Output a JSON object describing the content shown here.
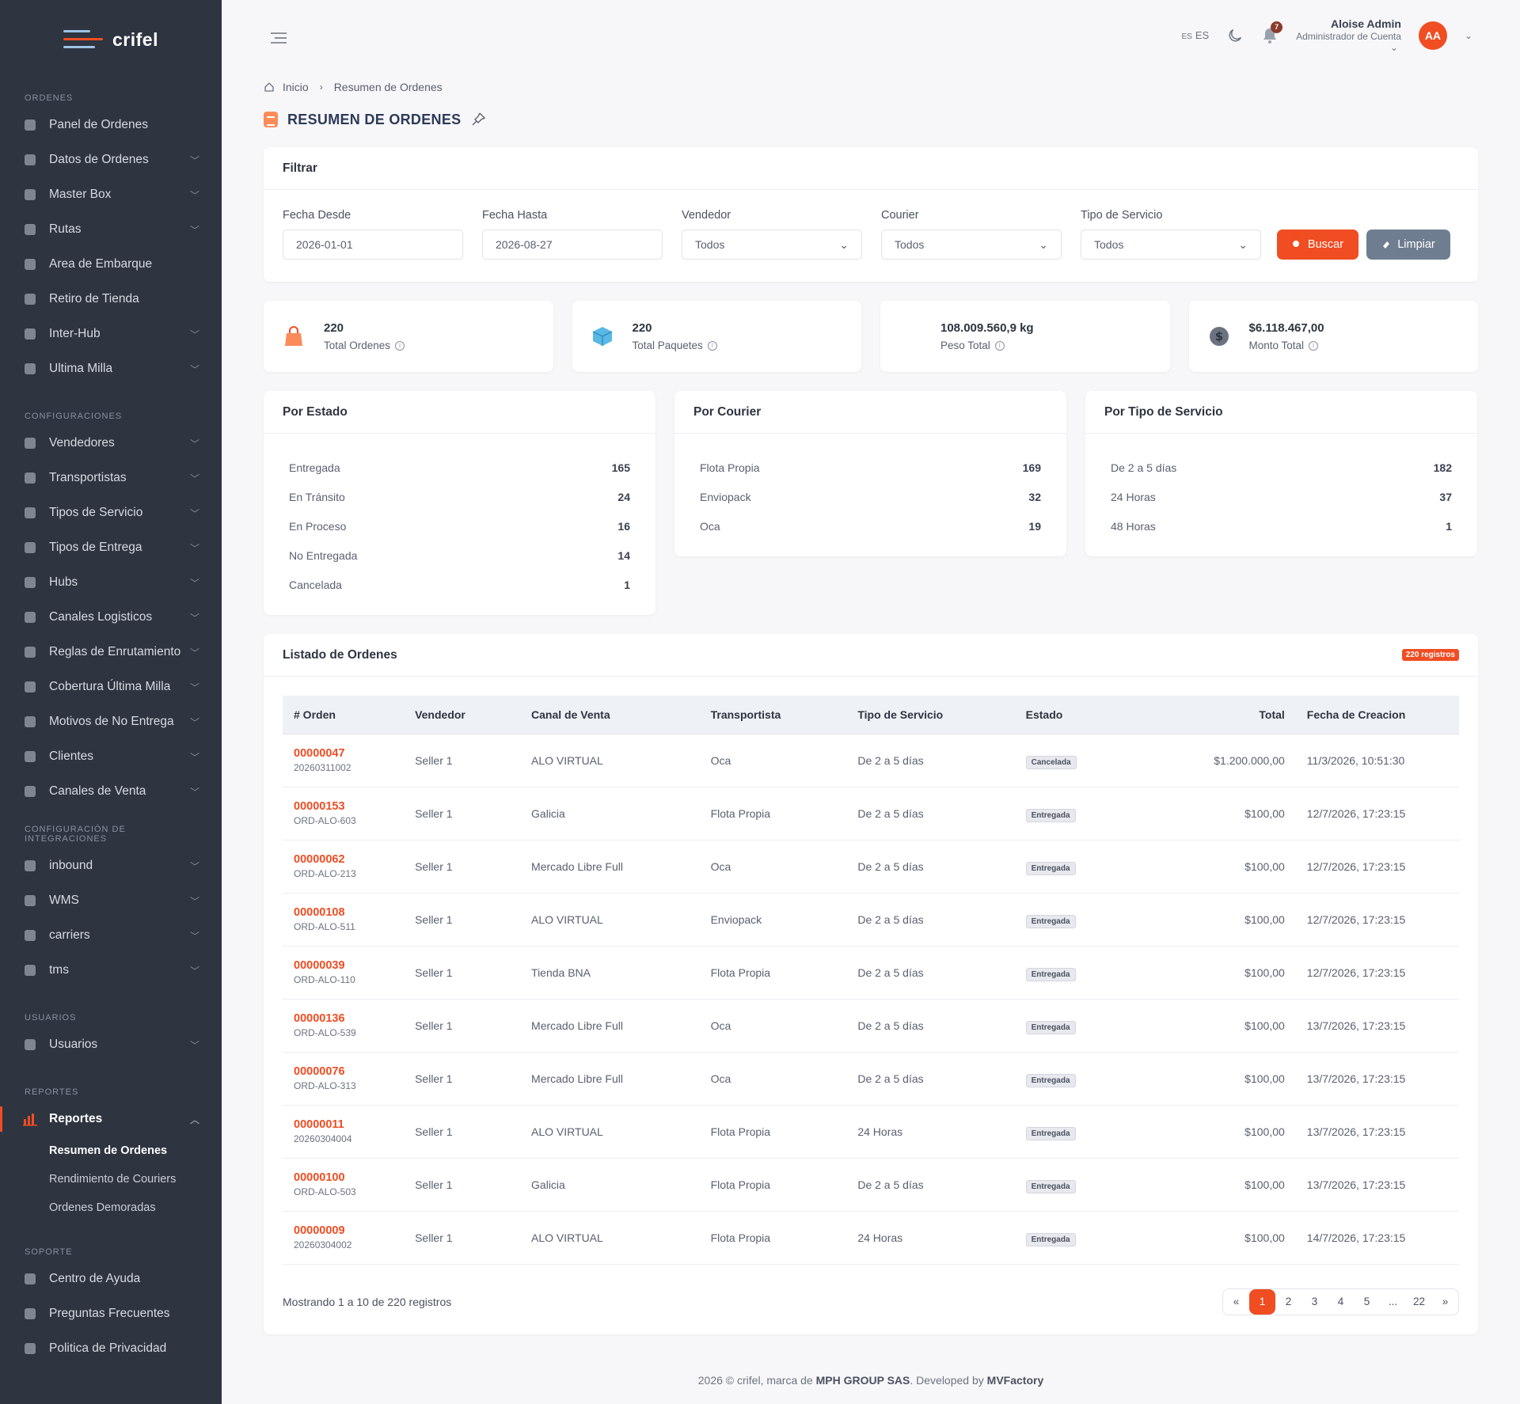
{
  "brand": {
    "name": "crifel"
  },
  "sidebar": {
    "sections": [
      {
        "title": "ORDENES",
        "items": [
          {
            "label": "Panel de Ordenes",
            "icon": "dashboard-icon",
            "chevron": false
          },
          {
            "label": "Datos de Ordenes",
            "icon": "box-icon",
            "chevron": true
          },
          {
            "label": "Master Box",
            "icon": "cube-icon",
            "chevron": true
          },
          {
            "label": "Rutas",
            "icon": "route-icon",
            "chevron": true
          },
          {
            "label": "Area de Embarque",
            "icon": "dock-icon",
            "chevron": false
          },
          {
            "label": "Retiro de Tienda",
            "icon": "store-icon",
            "chevron": false
          },
          {
            "label": "Inter-Hub",
            "icon": "building-icon",
            "chevron": true
          },
          {
            "label": "Ultima Milla",
            "icon": "delivery-icon",
            "chevron": true
          }
        ]
      },
      {
        "title": "CONFIGURACIONES",
        "items": [
          {
            "label": "Vendedores",
            "icon": "seller-icon",
            "chevron": true
          },
          {
            "label": "Transportistas",
            "icon": "truck-icon",
            "chevron": true
          },
          {
            "label": "Tipos de Servicio",
            "icon": "service-icon",
            "chevron": true
          },
          {
            "label": "Tipos de Entrega",
            "icon": "package-icon",
            "chevron": true
          },
          {
            "label": "Hubs",
            "icon": "hub-icon",
            "chevron": true
          },
          {
            "label": "Canales Logisticos",
            "icon": "logistics-icon",
            "chevron": true
          },
          {
            "label": "Reglas de Enrutamiento",
            "icon": "rules-icon",
            "chevron": true
          },
          {
            "label": "Cobertura Última Milla",
            "icon": "coverage-icon",
            "chevron": true
          },
          {
            "label": "Motivos de No Entrega",
            "icon": "reason-icon",
            "chevron": true
          },
          {
            "label": "Clientes",
            "icon": "clients-icon",
            "chevron": true
          },
          {
            "label": "Canales de Venta",
            "icon": "sales-channel-icon",
            "chevron": true
          }
        ]
      },
      {
        "title": "CONFIGURACIÓN DE INTEGRACIONES",
        "items": [
          {
            "label": "inbound",
            "icon": "inbound-icon",
            "chevron": true
          },
          {
            "label": "WMS",
            "icon": "wms-icon",
            "chevron": true
          },
          {
            "label": "carriers",
            "icon": "carriers-icon",
            "chevron": true
          },
          {
            "label": "tms",
            "icon": "tms-icon",
            "chevron": true
          }
        ]
      },
      {
        "title": "USUARIOS",
        "items": [
          {
            "label": "Usuarios",
            "icon": "users-icon",
            "chevron": true
          }
        ]
      },
      {
        "title": "REPORTES",
        "items": [
          {
            "label": "Reportes",
            "icon": "bar-chart-icon",
            "chevron": true,
            "active": true,
            "sub": [
              "Resumen de Ordenes",
              "Rendimiento de Couriers",
              "Ordenes Demoradas"
            ]
          }
        ]
      },
      {
        "title": "SOPORTE",
        "items": [
          {
            "label": "Centro de Ayuda",
            "icon": "help-icon",
            "chevron": false
          },
          {
            "label": "Preguntas Frecuentes",
            "icon": "faq-icon",
            "chevron": false
          },
          {
            "label": "Politica de Privacidad",
            "icon": "privacy-icon",
            "chevron": false
          }
        ]
      }
    ]
  },
  "topbar": {
    "lang_code": "ES",
    "lang_label": "ES",
    "notifications": "7",
    "user_name": "Aloise Admin",
    "user_role": "Administrador de Cuenta",
    "avatar": "AA"
  },
  "breadcrumb": {
    "home": "Inicio",
    "current": "Resumen de Ordenes"
  },
  "page": {
    "title": "RESUMEN DE ORDENES"
  },
  "filter": {
    "title": "Filtrar",
    "fecha_desde_label": "Fecha Desde",
    "fecha_desde": "2026-01-01",
    "fecha_hasta_label": "Fecha Hasta",
    "fecha_hasta": "2026-08-27",
    "vendedor_label": "Vendedor",
    "vendedor": "Todos",
    "courier_label": "Courier",
    "courier": "Todos",
    "tipo_label": "Tipo de Servicio",
    "tipo": "Todos",
    "buscar": "Buscar",
    "limpiar": "Limpiar"
  },
  "stats": [
    {
      "value": "220",
      "label": "Total Ordenes"
    },
    {
      "value": "220",
      "label": "Total Paquetes"
    },
    {
      "value": "108.009.560,9 kg",
      "label": "Peso Total"
    },
    {
      "value": "$6.118.467,00",
      "label": "Monto Total"
    }
  ],
  "breakdowns": [
    {
      "title": "Por Estado",
      "rows": [
        {
          "label": "Entregada",
          "value": "165"
        },
        {
          "label": "En Tránsito",
          "value": "24"
        },
        {
          "label": "En Proceso",
          "value": "16"
        },
        {
          "label": "No Entregada",
          "value": "14"
        },
        {
          "label": "Cancelada",
          "value": "1"
        }
      ]
    },
    {
      "title": "Por Courier",
      "rows": [
        {
          "label": "Flota Propia",
          "value": "169"
        },
        {
          "label": "Enviopack",
          "value": "32"
        },
        {
          "label": "Oca",
          "value": "19"
        }
      ]
    },
    {
      "title": "Por Tipo de Servicio",
      "rows": [
        {
          "label": "De 2 a 5 días",
          "value": "182"
        },
        {
          "label": "24 Horas",
          "value": "37"
        },
        {
          "label": "48 Horas",
          "value": "1"
        }
      ]
    }
  ],
  "list": {
    "title": "Listado de Ordenes",
    "badge": "220 registros",
    "columns": [
      "# Orden",
      "Vendedor",
      "Canal de Venta",
      "Transportista",
      "Tipo de Servicio",
      "Estado",
      "Total",
      "Fecha de Creacion"
    ],
    "rows": [
      {
        "orden": "00000047",
        "ref": "20260311002",
        "vendedor": "Seller 1",
        "canal": "ALO VIRTUAL",
        "transportista": "Oca",
        "tipo": "De 2 a 5 días",
        "estado": "Cancelada",
        "total": "$1.200.000,00",
        "fecha": "11/3/2026, 10:51:30"
      },
      {
        "orden": "00000153",
        "ref": "ORD-ALO-603",
        "vendedor": "Seller 1",
        "canal": "Galicia",
        "transportista": "Flota Propia",
        "tipo": "De 2 a 5 días",
        "estado": "Entregada",
        "total": "$100,00",
        "fecha": "12/7/2026, 17:23:15"
      },
      {
        "orden": "00000062",
        "ref": "ORD-ALO-213",
        "vendedor": "Seller 1",
        "canal": "Mercado Libre Full",
        "transportista": "Oca",
        "tipo": "De 2 a 5 días",
        "estado": "Entregada",
        "total": "$100,00",
        "fecha": "12/7/2026, 17:23:15"
      },
      {
        "orden": "00000108",
        "ref": "ORD-ALO-511",
        "vendedor": "Seller 1",
        "canal": "ALO VIRTUAL",
        "transportista": "Enviopack",
        "tipo": "De 2 a 5 días",
        "estado": "Entregada",
        "total": "$100,00",
        "fecha": "12/7/2026, 17:23:15"
      },
      {
        "orden": "00000039",
        "ref": "ORD-ALO-110",
        "vendedor": "Seller 1",
        "canal": "Tienda BNA",
        "transportista": "Flota Propia",
        "tipo": "De 2 a 5 días",
        "estado": "Entregada",
        "total": "$100,00",
        "fecha": "12/7/2026, 17:23:15"
      },
      {
        "orden": "00000136",
        "ref": "ORD-ALO-539",
        "vendedor": "Seller 1",
        "canal": "Mercado Libre Full",
        "transportista": "Oca",
        "tipo": "De 2 a 5 días",
        "estado": "Entregada",
        "total": "$100,00",
        "fecha": "13/7/2026, 17:23:15"
      },
      {
        "orden": "00000076",
        "ref": "ORD-ALO-313",
        "vendedor": "Seller 1",
        "canal": "Mercado Libre Full",
        "transportista": "Oca",
        "tipo": "De 2 a 5 días",
        "estado": "Entregada",
        "total": "$100,00",
        "fecha": "13/7/2026, 17:23:15"
      },
      {
        "orden": "00000011",
        "ref": "20260304004",
        "vendedor": "Seller 1",
        "canal": "ALO VIRTUAL",
        "transportista": "Flota Propia",
        "tipo": "24 Horas",
        "estado": "Entregada",
        "total": "$100,00",
        "fecha": "13/7/2026, 17:23:15"
      },
      {
        "orden": "00000100",
        "ref": "ORD-ALO-503",
        "vendedor": "Seller 1",
        "canal": "Galicia",
        "transportista": "Flota Propia",
        "tipo": "De 2 a 5 días",
        "estado": "Entregada",
        "total": "$100,00",
        "fecha": "13/7/2026, 17:23:15"
      },
      {
        "orden": "00000009",
        "ref": "20260304002",
        "vendedor": "Seller 1",
        "canal": "ALO VIRTUAL",
        "transportista": "Flota Propia",
        "tipo": "24 Horas",
        "estado": "Entregada",
        "total": "$100,00",
        "fecha": "14/7/2026, 17:23:15"
      }
    ],
    "showing": "Mostrando 1 a 10 de 220 registros",
    "pages": [
      "«",
      "1",
      "2",
      "3",
      "4",
      "5",
      "...",
      "22",
      "»"
    ],
    "current_page": "1"
  },
  "footer": {
    "prefix": "2026 © crifel, marca de ",
    "company": "MPH GROUP SAS",
    "mid": ". Developed by ",
    "dev": "MVFactory"
  },
  "colors": {
    "accent": "#f04d23",
    "sidebar": "#2e3440",
    "button_secondary": "#6f7d90"
  }
}
